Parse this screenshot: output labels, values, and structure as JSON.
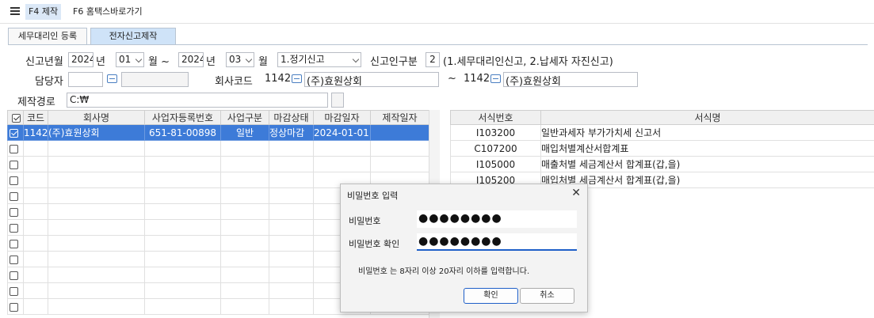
{
  "toolbar": {
    "f4": "F4 제작",
    "f6": "F6 홈택스바로가기"
  },
  "tabs": [
    "세무대리인 등록",
    "전자신고제작"
  ],
  "form": {
    "period_label": "신고년월",
    "year_from": "2024",
    "year_unit": "년",
    "month_from": "01",
    "month_unit": "월 ~",
    "year_to": "2024",
    "year_unit2": "년",
    "month_to": "03",
    "month_unit2": "월",
    "report_type": "1.정기신고",
    "reporter_label": "신고인구분",
    "reporter_value": "2",
    "reporter_hint": "(1.세무대리인신고, 2.납세자 자진신고)",
    "manager_label": "담당자",
    "company_label": "회사코드",
    "company_from_code": "1142",
    "company_from_name": "(주)효원상회",
    "tilde": "~",
    "company_to_code": "1142",
    "company_to_name": "(주)효원상회",
    "path_label": "제작경로",
    "path_value": "C:₩"
  },
  "left_grid": {
    "headers": [
      "코드",
      "회사명",
      "사업자등록번호",
      "사업구분",
      "마감상태",
      "마감일자",
      "제작일자"
    ],
    "rows": [
      {
        "code": "1142",
        "name": "(주)효원상회",
        "biz_no": "651-81-00898",
        "type": "일반",
        "status": "정상마감",
        "close_date": "2024-01-01",
        "make_date": ""
      }
    ],
    "empty_rows": 11
  },
  "right_grid": {
    "headers": [
      "서식번호",
      "서식명"
    ],
    "rows": [
      {
        "code": "I103200",
        "name": "일반과세자 부가가치세 신고서"
      },
      {
        "code": "C107200",
        "name": "매입처별계산서합계표"
      },
      {
        "code": "I105000",
        "name": "매출처별 세금계산서 합계표(갑,을)"
      },
      {
        "code": "I105200",
        "name": "매입처별 세금계산서 합계표(갑,을)"
      }
    ]
  },
  "dialog": {
    "title": "비밀번호 입력",
    "pw_label": "비밀번호",
    "pw_value": "●●●●●●●●",
    "pw_confirm_label": "비밀번호 확인",
    "pw_confirm_value": "●●●●●●●●",
    "message": "비밀번호 는 8자리 이상 20자리 이하를 입력합니다.",
    "ok": "확인",
    "cancel": "취소"
  }
}
